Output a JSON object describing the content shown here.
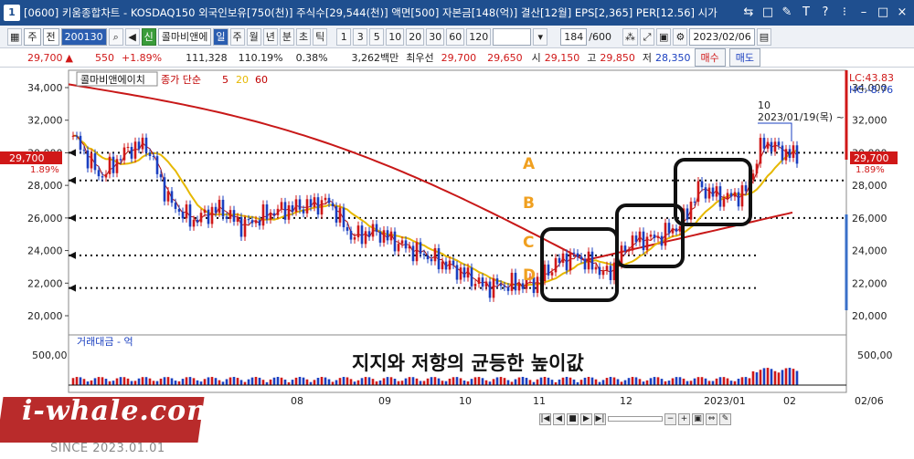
{
  "titlebar": {
    "window_number": "1",
    "title": "[0600] 키움종합차트 - KOSDAQ150 외국인보유[750(천)] 주식수[29,544(천)] 액면[500] 자본금[148(억)] 결산[12월] EPS[2,365] PER[12.56] 시가",
    "buttons": [
      "⇆",
      "□",
      "✎",
      "T",
      "?",
      "⁝",
      "–",
      "□",
      "×"
    ]
  },
  "toolbar": {
    "period_select": "주",
    "market_select": "전",
    "code": "200130",
    "signal_label": "신",
    "stock_name": "콜마비앤에",
    "period_buttons": [
      "일",
      "주",
      "월",
      "년",
      "분",
      "초",
      "틱"
    ],
    "active_period": "일",
    "minute_buttons": [
      "1",
      "3",
      "5",
      "10",
      "20",
      "30",
      "60",
      "120"
    ],
    "count": "184",
    "count_total": "/600",
    "date": "2023/02/06"
  },
  "quote": {
    "price": "29,700",
    "change_arrow": "▲",
    "change": "550",
    "change_pct": "+1.89%",
    "volume": "111,328",
    "volume_ratio": "110.19%",
    "turnover": "0.38%",
    "amount": "3,262백만",
    "best_quote_label": "최우선",
    "best_ask": "29,700",
    "best_bid": "29,650",
    "open_label": "시",
    "open": "29,150",
    "high_label": "고",
    "high": "29,850",
    "low_label": "저",
    "low": "28,350",
    "buy_label": "매수",
    "sell_label": "매도"
  },
  "price_pane": {
    "stock_label": "콜마비앤에이치",
    "indicator_label": "종가 단순",
    "ma_periods": [
      "5",
      "20",
      "60"
    ],
    "ma_colors": [
      "#c00000",
      "#e0b800",
      "#c00000"
    ],
    "lc_label": "LC:43.83",
    "hc_label": "HC:-8.76",
    "current_price_tag": "29,700",
    "current_pct_tag": "1.89%",
    "y_ticks": [
      "34,000",
      "32,000",
      "30,000",
      "28,000",
      "26,000",
      "24,000",
      "22,000",
      "20,000"
    ],
    "peak_annotation_count": "10",
    "peak_annotation_date": "2023/01/19(목) ~",
    "level_labels": [
      "A",
      "B",
      "C",
      "D"
    ]
  },
  "volume_pane": {
    "label": "거래대금 - 억",
    "y_ticks": [
      "500,00",
      "500,00"
    ],
    "overlay_text": "지지와 저항의 균등한 높이값"
  },
  "x_axis": {
    "labels": [
      "08",
      "09",
      "10",
      "11",
      "12",
      "2023/01",
      "02"
    ],
    "right_label": "02/06"
  },
  "branding": {
    "logo": "i-whale.com",
    "since": "SINCE 2023.01.01"
  },
  "chart_data": {
    "type": "candlestick",
    "y_range": [
      20000,
      35000
    ],
    "horizontal_levels": [
      30000,
      28300,
      26000,
      23700,
      21700
    ],
    "current_price": 29700,
    "peak_price": 31000
  }
}
